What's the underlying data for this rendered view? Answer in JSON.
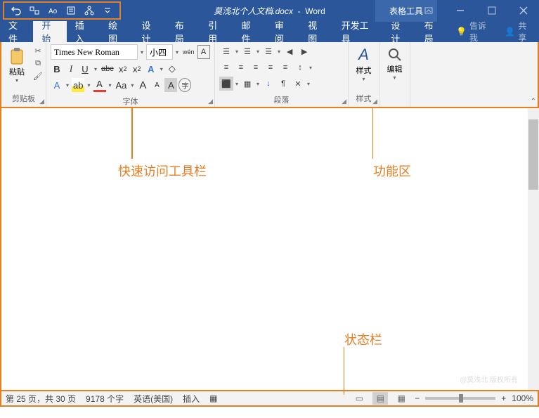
{
  "titlebar": {
    "doc_name": "莫浅北个人文档.docx",
    "app_name": "Word",
    "tool_tab": "表格工具"
  },
  "qat": {
    "items": [
      "undo",
      "touch-mode",
      "read-aloud",
      "properties",
      "relations",
      "more"
    ]
  },
  "menu": {
    "file": "文件",
    "home": "开始",
    "insert": "插入",
    "draw": "绘图",
    "design": "设计",
    "layout": "布局",
    "references": "引用",
    "mailings": "邮件",
    "review": "审阅",
    "view": "视图",
    "dev": "开发工具",
    "tbl_design": "设计",
    "tbl_layout": "布局",
    "tell_me": "告诉我",
    "share": "共享"
  },
  "ribbon": {
    "clipboard": {
      "paste": "粘贴",
      "label": "剪贴板"
    },
    "font": {
      "name": "Times New Roman",
      "size": "小四",
      "wen": "wén",
      "A_box": "A",
      "label": "字体",
      "B": "B",
      "I": "I",
      "U": "U",
      "abc": "abc",
      "x2": "x",
      "x_2": "x",
      "Aa": "Aa",
      "A_plus": "A",
      "A_minus": "A",
      "A_bg": "A",
      "circled": "字"
    },
    "para": {
      "label": "段落"
    },
    "style": {
      "A": "A",
      "label_btn": "样式",
      "label": "样式"
    },
    "edit": {
      "label": "编辑"
    }
  },
  "annotations": {
    "qat": "快速访问工具栏",
    "ribbon": "功能区",
    "status": "状态栏"
  },
  "status": {
    "page": "第 25 页，共 30 页",
    "words": "9178 个字",
    "lang": "英语(美国)",
    "mode": "插入",
    "zoom": "100%"
  },
  "watermark": "@莫浅北 版权所有"
}
